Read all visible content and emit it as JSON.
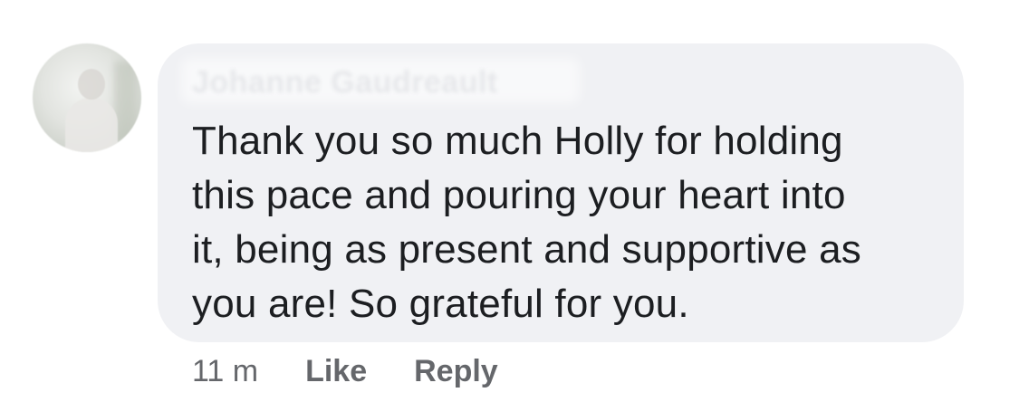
{
  "comment": {
    "author": "Johanne Gaudreault",
    "text_lines": [
      "Thank you so much Holly for holding",
      "this pace and pouring your heart into",
      "it, being as present and supportive as",
      "you are! So grateful for you."
    ],
    "timestamp": "11 m",
    "actions": {
      "like_label": "Like",
      "reply_label": "Reply"
    }
  },
  "colors": {
    "bubble_background": "#f0f1f4",
    "text": "#1c1e21",
    "meta_text": "#65676b"
  }
}
